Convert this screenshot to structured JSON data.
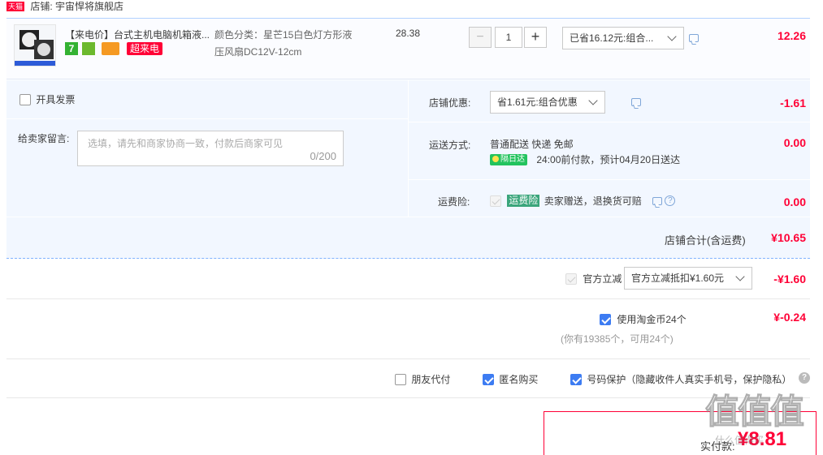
{
  "shop": {
    "badge": "天猫",
    "label": "店铺: 宇宙悍将旗舰店"
  },
  "item": {
    "title": "【来电价】台式主机电脑机箱液...",
    "thumb_caption": "风扇",
    "badge_seven": "7",
    "badge_super": "超来电",
    "sku_line1": "颜色分类：星芒15白色灯方形液",
    "sku_line2": "压风扇DC12V-12cm",
    "unit_price": "28.38",
    "qty": "1",
    "qty_minus": "−",
    "qty_plus": "+",
    "discount_select": "已省16.12元:组合...",
    "subtotal": "12.26"
  },
  "invoice": {
    "label": "开具发票"
  },
  "message": {
    "label": "给卖家留言:",
    "placeholder": "选填，请先和商家协商一致，付款后商家可见",
    "counter": "0/200"
  },
  "shop_discount": {
    "label": "店铺优惠:",
    "select": "省1.61元:组合优惠",
    "amount": "-1.61"
  },
  "shipping": {
    "label": "运送方式:",
    "line1": "普通配送 快递 免邮",
    "badge": "隔日达",
    "line2": "24:00前付款，预计04月20日送达",
    "amount": "0.00"
  },
  "insurance": {
    "label": "运费险:",
    "badge": "运费险",
    "text": "卖家赠送，退换货可赔",
    "help": "?",
    "amount": "0.00"
  },
  "shop_total": {
    "label": "店铺合计(含运费)",
    "amount": "¥10.65"
  },
  "official": {
    "label": "官方立减",
    "select": "官方立减抵扣¥1.60元",
    "amount": "-¥1.60"
  },
  "taojinbi": {
    "label": "使用淘金币24个",
    "sub": "(你有19385个，可用24个)",
    "amount": "¥-0.24"
  },
  "options": {
    "friend_pay": "朋友代付",
    "anonymous": "匿名购买",
    "privacy": "号码保护（隐藏收件人真实手机号，保护隐私）",
    "help": "?"
  },
  "pay": {
    "label": "实付款:",
    "amount": "¥8.81"
  },
  "watermark": {
    "text": "值值值",
    "sub": "什么值得买"
  },
  "colors": {
    "accent_red": "#ff0036",
    "checkbox_blue": "#3d7cf2",
    "panel_blue": "#f2f7ff",
    "tmall_red": "#ff0036"
  }
}
